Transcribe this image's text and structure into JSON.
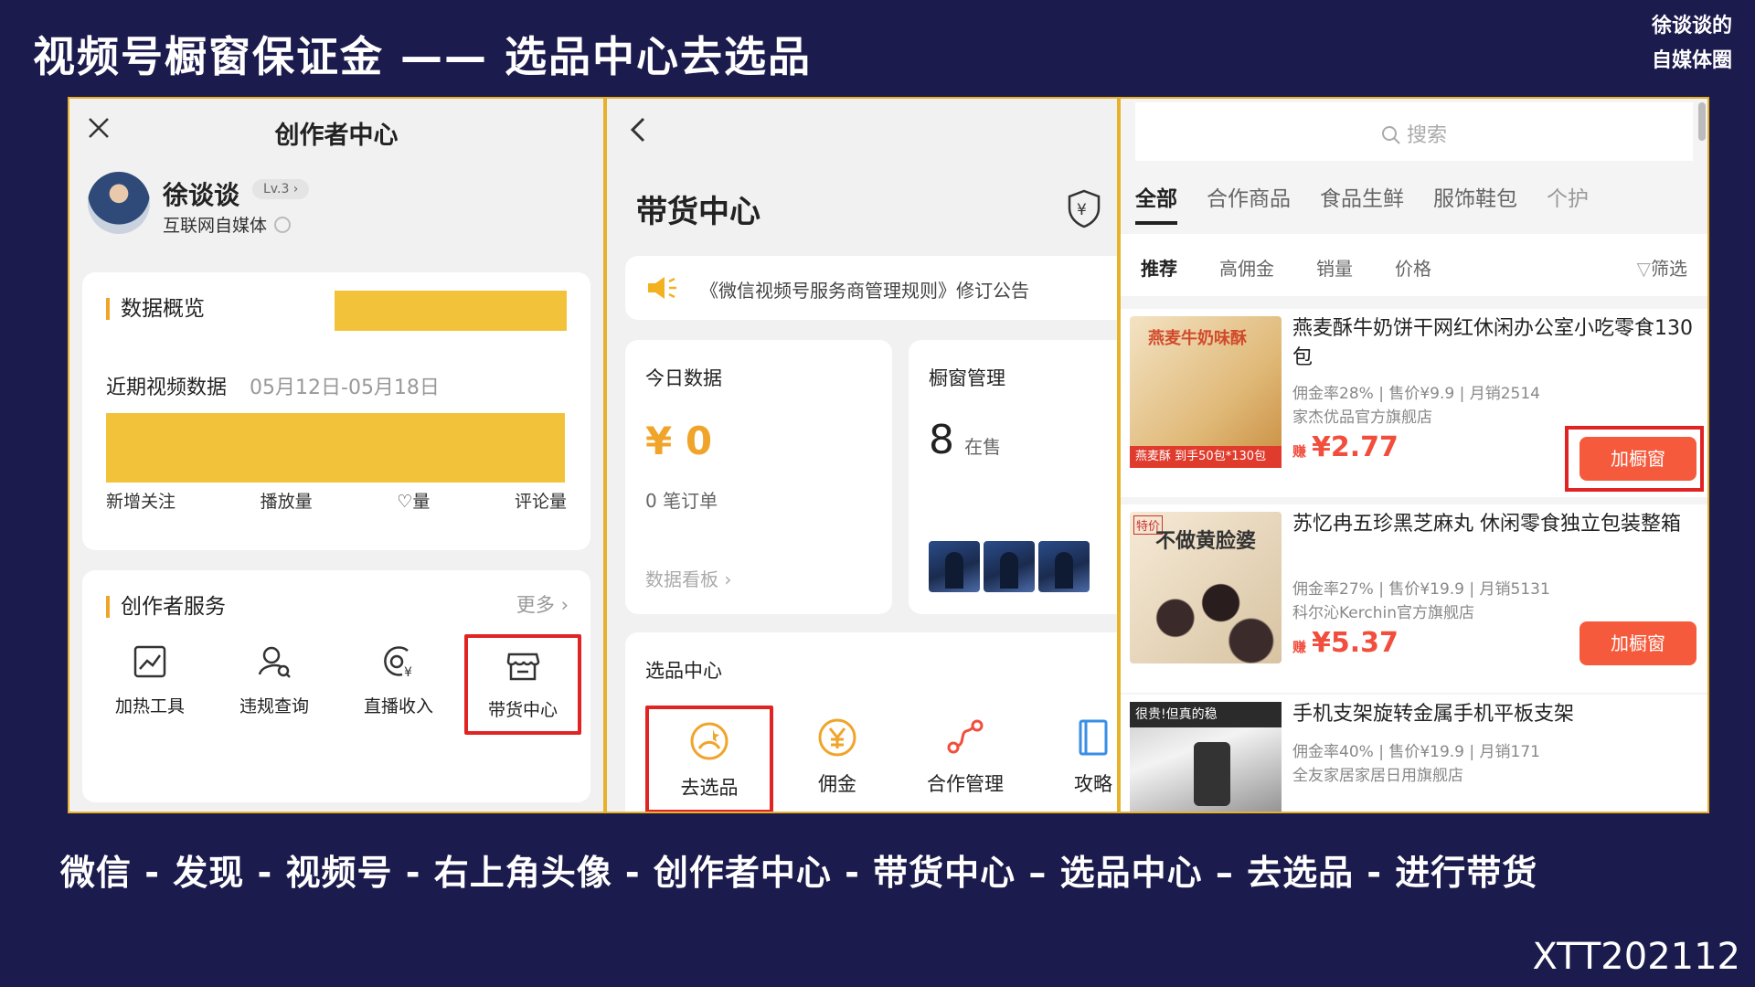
{
  "slide": {
    "title": "视频号橱窗保证金 —— 选品中心去选品",
    "logo_line1": "徐谈谈的",
    "logo_line2": "自媒体圈",
    "subtitle": "微信 - 发现 - 视频号 - 右上角头像 - 创作者中心 - 带货中心 – 选品中心 – 去选品 - 进行带货",
    "code": "XTT202112"
  },
  "creator": {
    "title": "创作者中心",
    "name": "徐谈谈",
    "level": "Lv.3 ›",
    "tag": "互联网自媒体",
    "overview_title": "数据概览",
    "recent_label": "近期视频数据",
    "date_range": "05月12日-05月18日",
    "stat_labels": [
      "新增关注",
      "播放量",
      "♡量",
      "评论量"
    ],
    "services_title": "创作者服务",
    "more": "更多 ›",
    "services": [
      {
        "label": "加热工具",
        "icon": "chart-icon"
      },
      {
        "label": "违规查询",
        "icon": "user-search-icon"
      },
      {
        "label": "直播收入",
        "icon": "live-income-icon"
      },
      {
        "label": "带货中心",
        "icon": "store-icon"
      }
    ]
  },
  "sales": {
    "title": "带货中心",
    "notice": "《微信视频号服务商管理规则》修订公告",
    "today_title": "今日数据",
    "today_amount": "¥ 0",
    "today_orders": "0 笔订单",
    "dashboard_link": "数据看板 ›",
    "window_title": "橱窗管理",
    "window_count": "8",
    "window_unit": "在售",
    "selection_title": "选品中心",
    "selection_items": [
      {
        "label": "去选品",
        "icon": "select-product-icon"
      },
      {
        "label": "佣金",
        "icon": "yen-icon"
      },
      {
        "label": "合作管理",
        "icon": "cooperation-icon"
      },
      {
        "label": "攻略",
        "icon": "guide-icon"
      }
    ]
  },
  "market": {
    "search_placeholder": "搜索",
    "tabs": [
      "全部",
      "合作商品",
      "食品生鲜",
      "服饰鞋包",
      "个护"
    ],
    "sort": [
      "推荐",
      "高佣金",
      "销量",
      "价格"
    ],
    "filter": "筛选",
    "products": [
      {
        "name": "燕麦酥牛奶饼干网红休闲办公室小吃零食130包",
        "meta": "佣金率28% | 售价¥9.9 | 月销2514",
        "shop": "家杰优品官方旗舰店",
        "earn": "赚",
        "price": "¥2.77",
        "button": "加橱窗",
        "img_text": "燕麦牛奶味酥",
        "img_tag": "燕麦酥",
        "img_tag2": "到手50包*130包"
      },
      {
        "name": "苏忆冉五珍黑芝麻丸 休闲零食独立包装整箱",
        "meta": "佣金率27% | 售价¥19.9 | 月销5131",
        "shop": "科尔沁Kerchin官方旗舰店",
        "earn": "赚",
        "price": "¥5.37",
        "button": "加橱窗",
        "img_text": "不做黄脸婆",
        "img_tag": "特价"
      },
      {
        "name": "手机支架旋转金属手机平板支架",
        "meta": "佣金率40% | 售价¥19.9 | 月销171",
        "shop": "全友家居家居日用旗舰店",
        "img_text": "很贵!但真的稳"
      }
    ]
  }
}
